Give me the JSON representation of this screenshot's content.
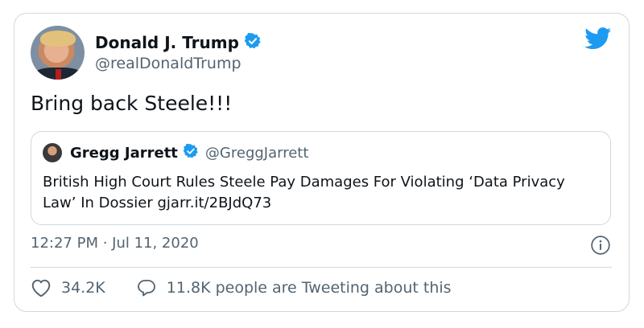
{
  "author": {
    "name": "Donald J. Trump",
    "handle": "@realDonaldTrump",
    "verified": true
  },
  "tweet": {
    "text": "Bring back Steele!!!",
    "timestamp": "12:27 PM · Jul 11, 2020"
  },
  "quoted_tweet": {
    "name": "Gregg Jarrett",
    "handle": "@GreggJarrett",
    "verified": true,
    "text": "British High Court Rules Steele Pay Damages For Violating ‘Data Privacy Law’ In Dossier gjarr.it/2BJdQ73"
  },
  "actions": {
    "likes": "34.2K",
    "conversation": "11.8K people are Tweeting about this"
  },
  "colors": {
    "brand_blue": "#1d9bf0",
    "text_primary": "#0f1419",
    "text_secondary": "#536471",
    "border": "#cfd9de"
  },
  "icons": [
    "verified-badge-icon",
    "twitter-bird-icon",
    "info-icon",
    "heart-icon",
    "reply-bubble-icon"
  ]
}
